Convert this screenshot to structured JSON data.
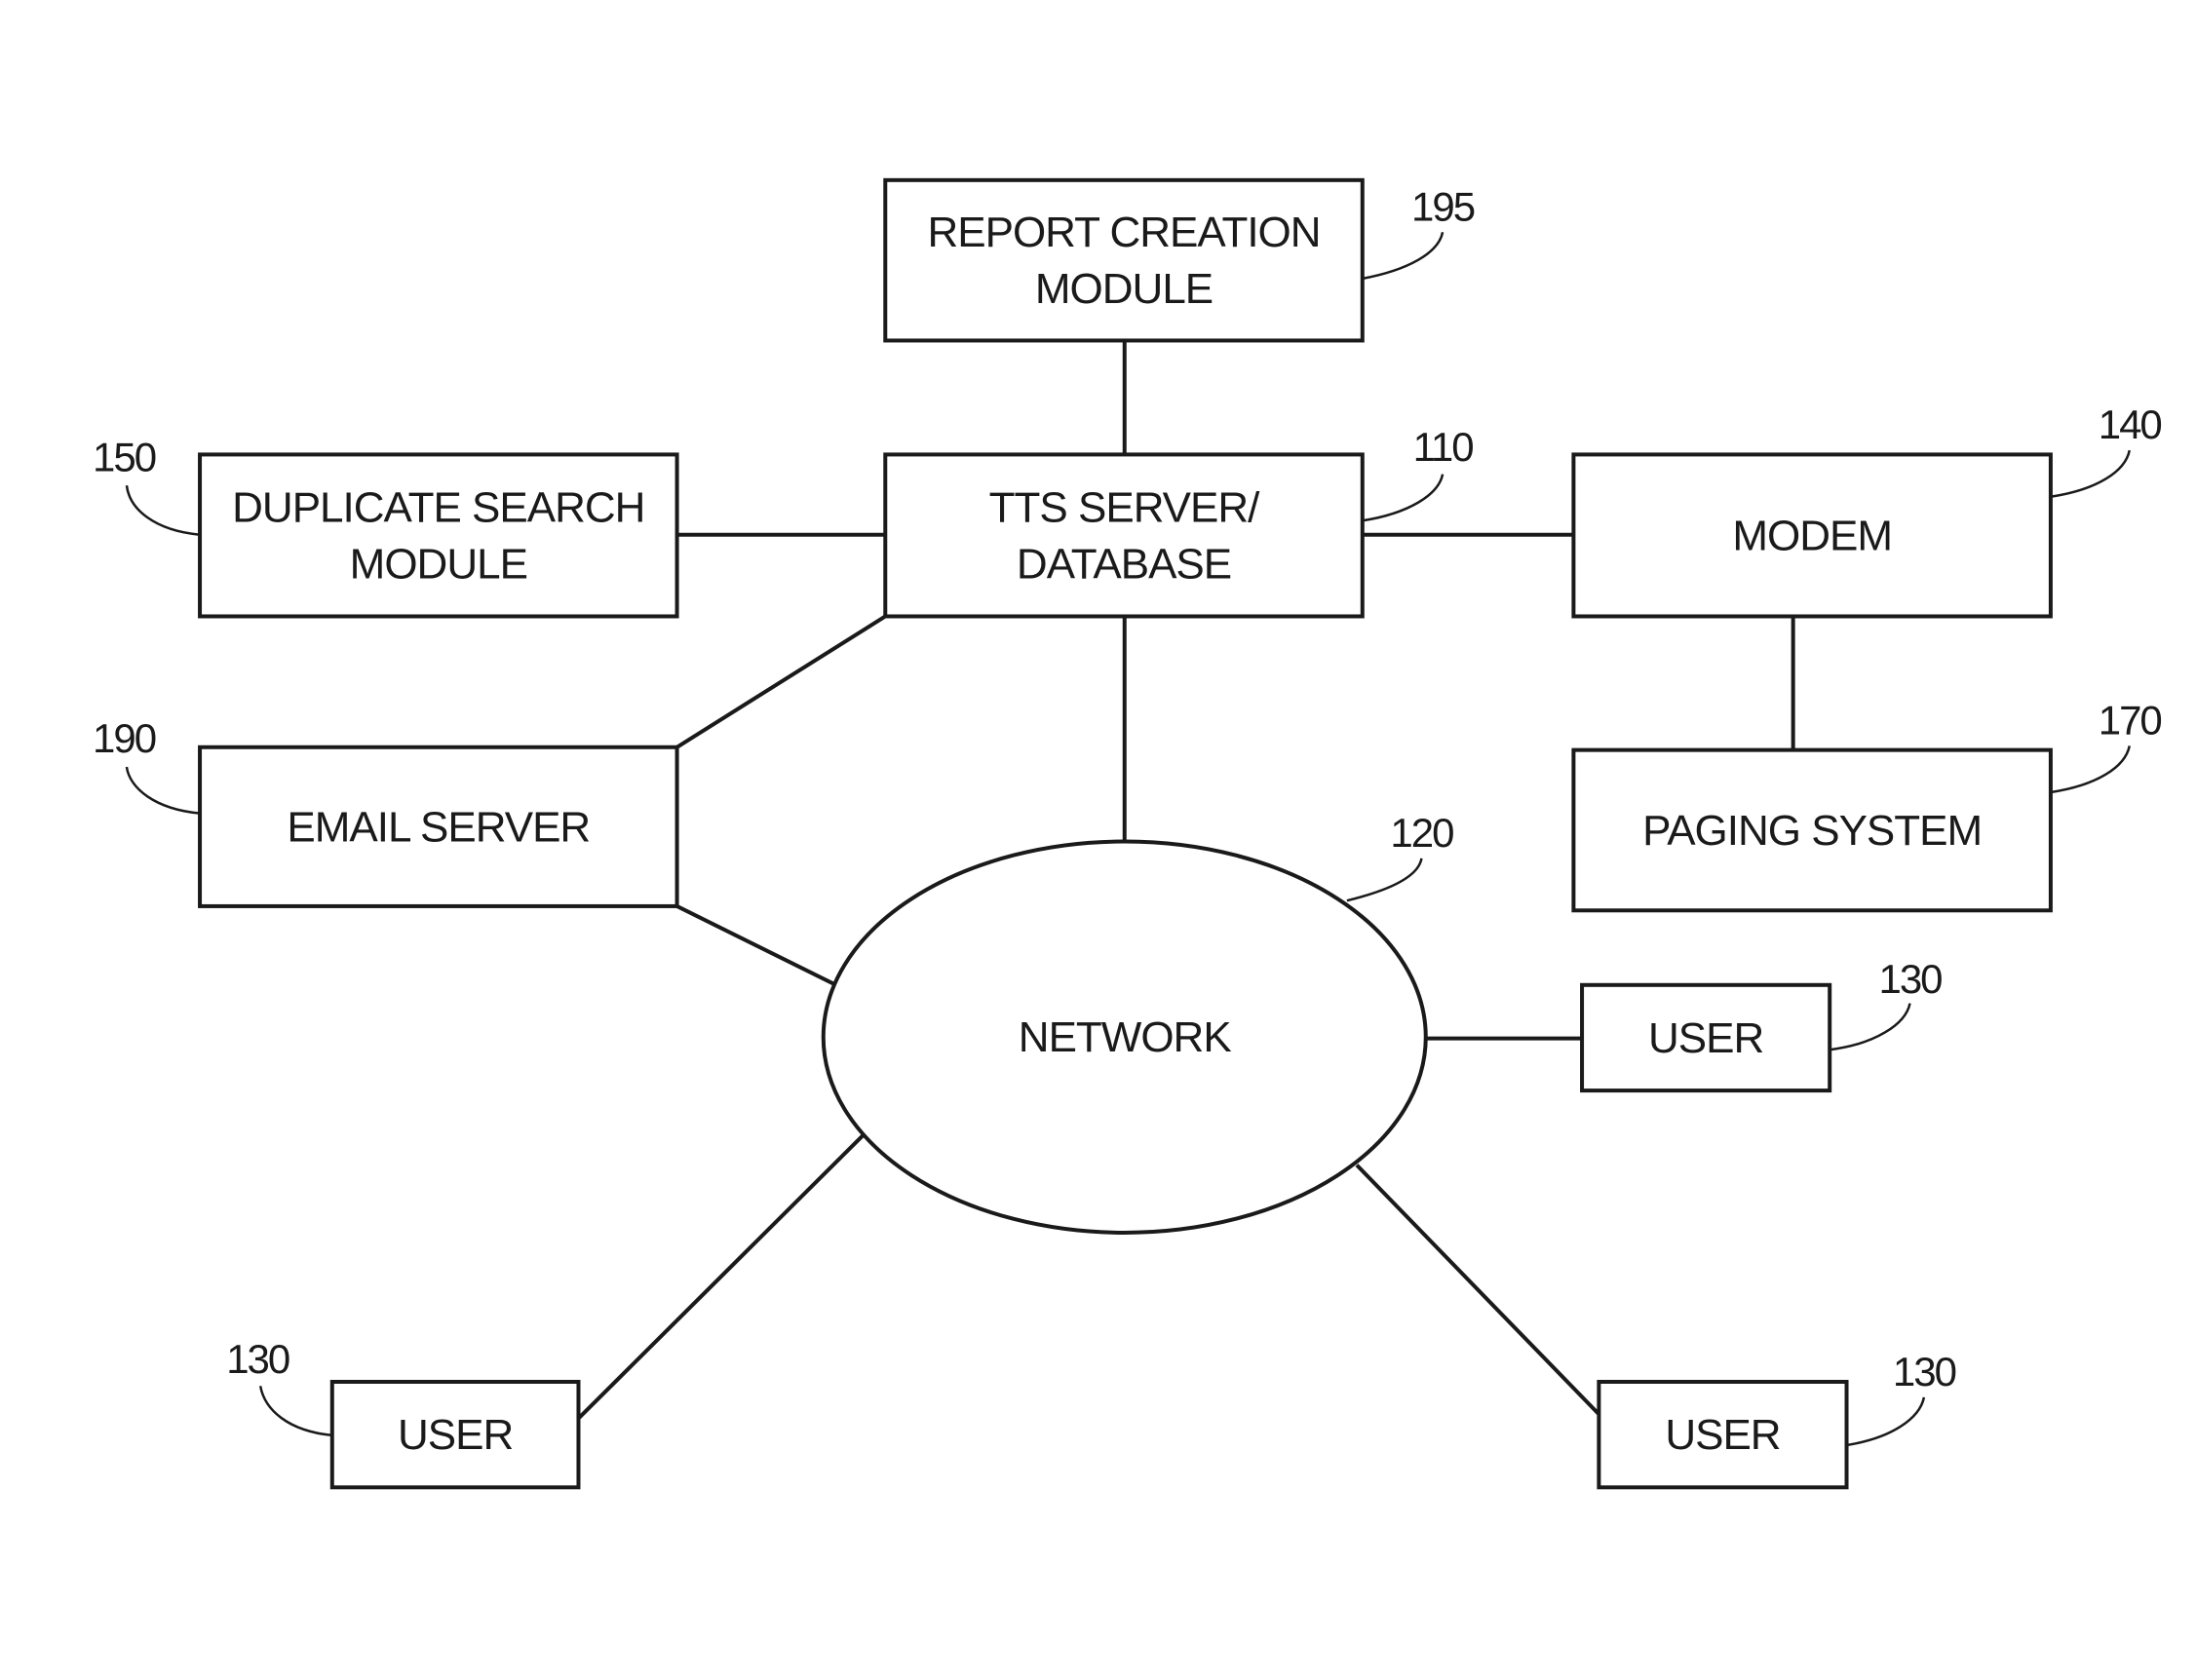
{
  "diagram": {
    "nodes": [
      {
        "id": "report",
        "ref": "195",
        "lines": [
          "REPORT CREATION",
          "MODULE"
        ]
      },
      {
        "id": "tts",
        "ref": "110",
        "lines": [
          "TTS SERVER/",
          "DATABASE"
        ]
      },
      {
        "id": "duplicate",
        "ref": "150",
        "lines": [
          "DUPLICATE SEARCH",
          "MODULE"
        ]
      },
      {
        "id": "modem",
        "ref": "140",
        "lines": [
          "MODEM"
        ]
      },
      {
        "id": "email",
        "ref": "190",
        "lines": [
          "EMAIL SERVER"
        ]
      },
      {
        "id": "paging",
        "ref": "170",
        "lines": [
          "PAGING SYSTEM"
        ]
      },
      {
        "id": "network",
        "ref": "120",
        "lines": [
          "NETWORK"
        ]
      },
      {
        "id": "user_right",
        "ref": "130",
        "lines": [
          "USER"
        ]
      },
      {
        "id": "user_bottom_left",
        "ref": "130",
        "lines": [
          "USER"
        ]
      },
      {
        "id": "user_bottom_right",
        "ref": "130",
        "lines": [
          "USER"
        ]
      }
    ],
    "edges": [
      [
        "report",
        "tts"
      ],
      [
        "duplicate",
        "tts"
      ],
      [
        "tts",
        "modem"
      ],
      [
        "modem",
        "paging"
      ],
      [
        "tts",
        "email"
      ],
      [
        "tts",
        "network"
      ],
      [
        "email",
        "network"
      ],
      [
        "network",
        "user_right"
      ],
      [
        "network",
        "user_bottom_left"
      ],
      [
        "network",
        "user_bottom_right"
      ]
    ]
  }
}
